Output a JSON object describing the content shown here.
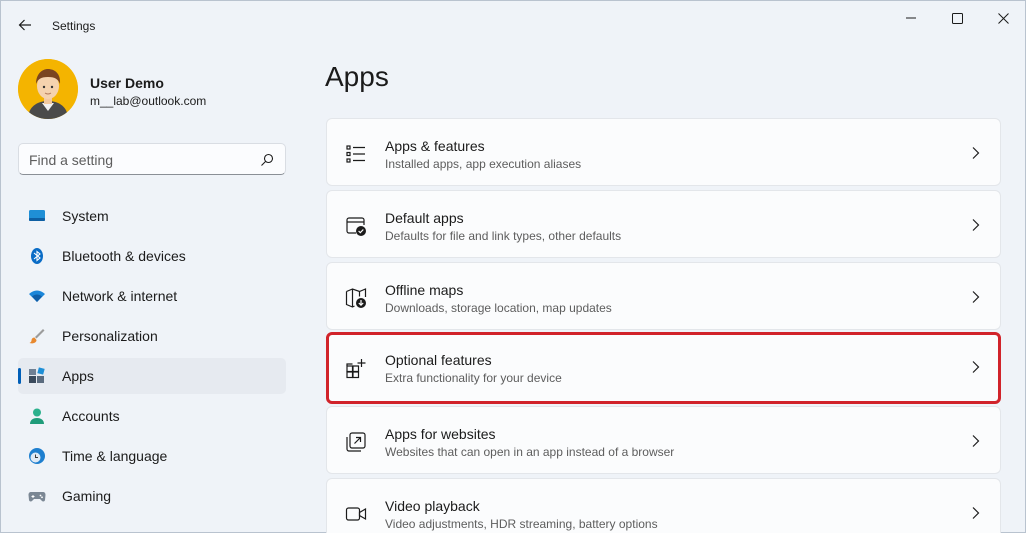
{
  "window": {
    "title": "Settings"
  },
  "profile": {
    "name": "User Demo",
    "email": "m__lab@outlook.com"
  },
  "search": {
    "placeholder": "Find a setting",
    "value": ""
  },
  "nav": [
    {
      "label": "System",
      "icon": "system-icon"
    },
    {
      "label": "Bluetooth & devices",
      "icon": "bluetooth-icon"
    },
    {
      "label": "Network & internet",
      "icon": "wifi-icon"
    },
    {
      "label": "Personalization",
      "icon": "brush-icon"
    },
    {
      "label": "Apps",
      "icon": "apps-icon",
      "active": true
    },
    {
      "label": "Accounts",
      "icon": "accounts-icon"
    },
    {
      "label": "Time & language",
      "icon": "clock-globe-icon"
    },
    {
      "label": "Gaming",
      "icon": "gamepad-icon"
    }
  ],
  "page": {
    "title": "Apps"
  },
  "cards": [
    {
      "title": "Apps & features",
      "desc": "Installed apps, app execution aliases",
      "icon": "list-icon"
    },
    {
      "title": "Default apps",
      "desc": "Defaults for file and link types, other defaults",
      "icon": "default-apps-icon"
    },
    {
      "title": "Offline maps",
      "desc": "Downloads, storage location, map updates",
      "icon": "map-icon"
    },
    {
      "title": "Optional features",
      "desc": "Extra functionality for your device",
      "icon": "optional-features-icon",
      "highlighted": true
    },
    {
      "title": "Apps for websites",
      "desc": "Websites that can open in an app instead of a browser",
      "icon": "open-in-app-icon"
    },
    {
      "title": "Video playback",
      "desc": "Video adjustments, HDR streaming, battery options",
      "icon": "video-icon"
    }
  ],
  "colors": {
    "accent": "#005fb8",
    "highlight": "#d1232a",
    "background": "#eff3f8"
  }
}
